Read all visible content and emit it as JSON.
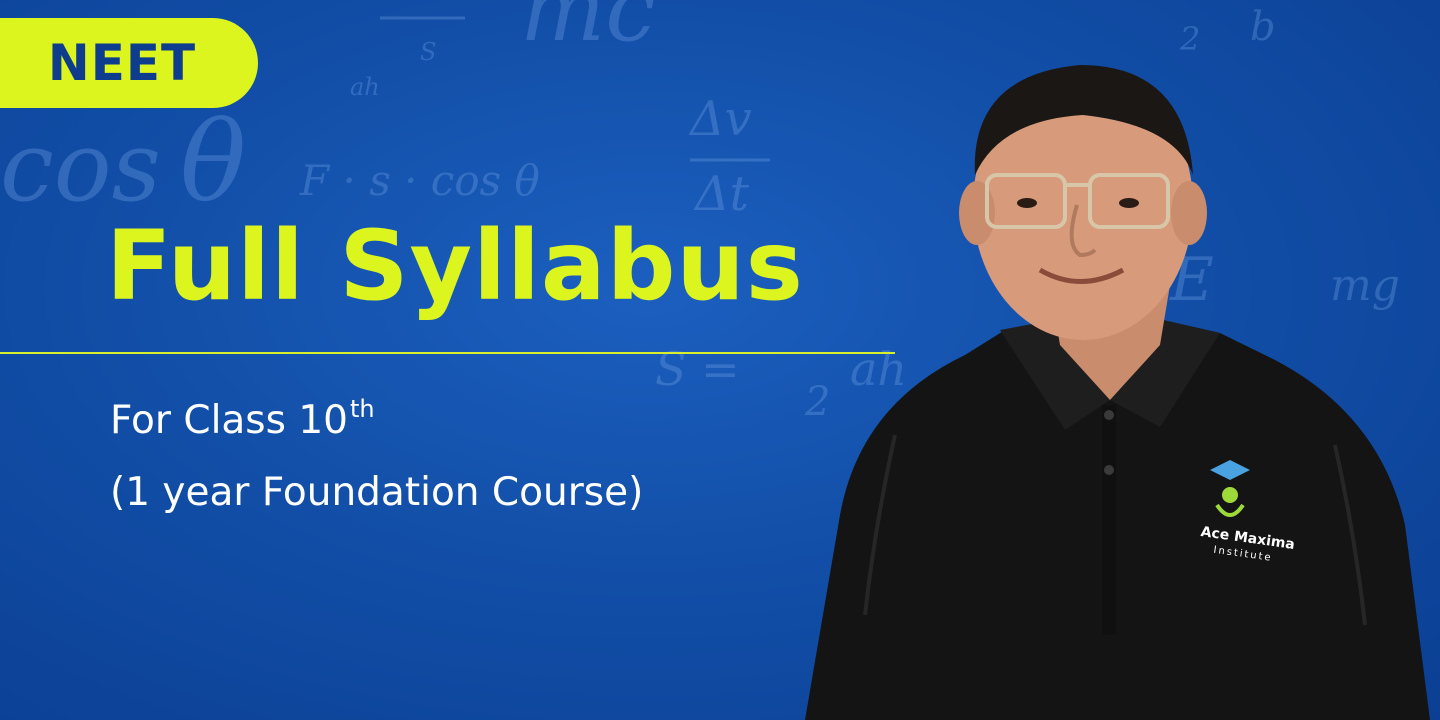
{
  "badge": {
    "label": "NEET"
  },
  "headline": {
    "title": "Full Syllabus"
  },
  "subtitle": {
    "line1": "For Class 10",
    "line1_suffix": "th",
    "line2": "(1 year Foundation Course)"
  },
  "logo": {
    "name": "Ace Maxima",
    "tagline": "Institute"
  },
  "colors": {
    "background": "#124fa8",
    "accent": "#dcf51e",
    "badge_text": "#0d3d8c",
    "text": "#ffffff",
    "shirt": "#141414"
  }
}
